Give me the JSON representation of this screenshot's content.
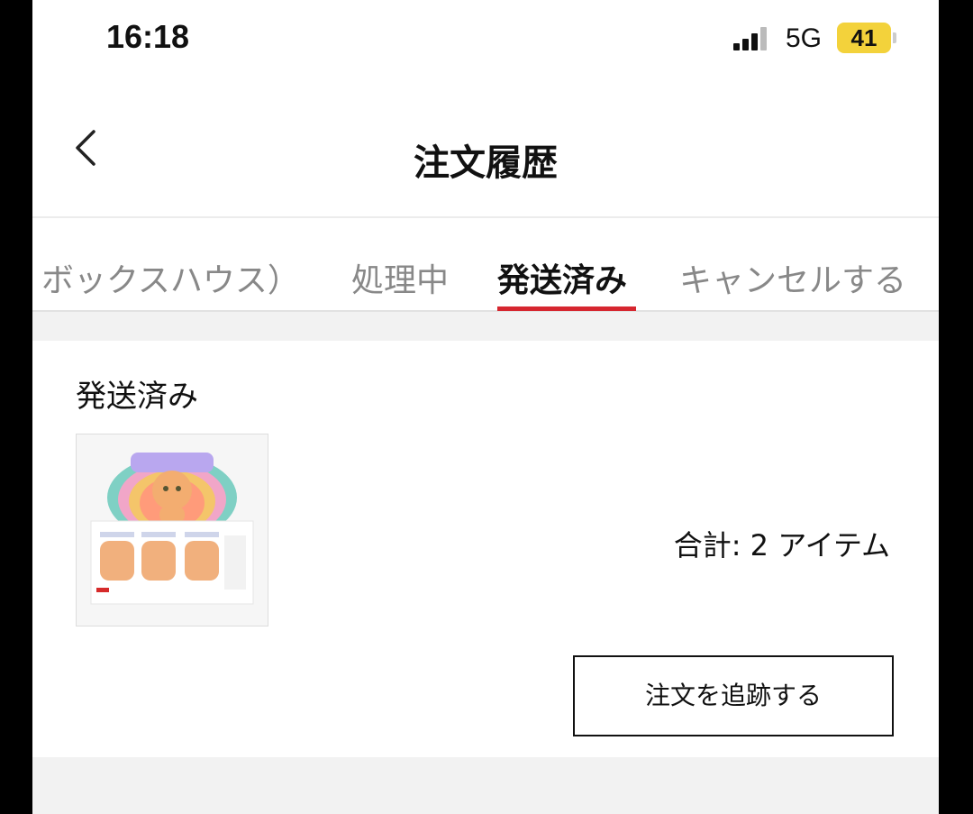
{
  "status_bar": {
    "time": "16:18",
    "network": "5G",
    "battery": "41"
  },
  "header": {
    "title": "注文履歴",
    "back_icon": "chevron-left-icon"
  },
  "tabs": [
    {
      "label": "ボックスハウス）",
      "active": false
    },
    {
      "label": "処理中",
      "active": false
    },
    {
      "label": "発送済み",
      "active": true
    },
    {
      "label": "キャンセルする",
      "active": false
    }
  ],
  "order": {
    "status": "発送済み",
    "total": "合計: 2 アイテム",
    "track_button": "注文を追跡する"
  },
  "colors": {
    "accent": "#d6262f",
    "battery": "#f3d23b"
  }
}
